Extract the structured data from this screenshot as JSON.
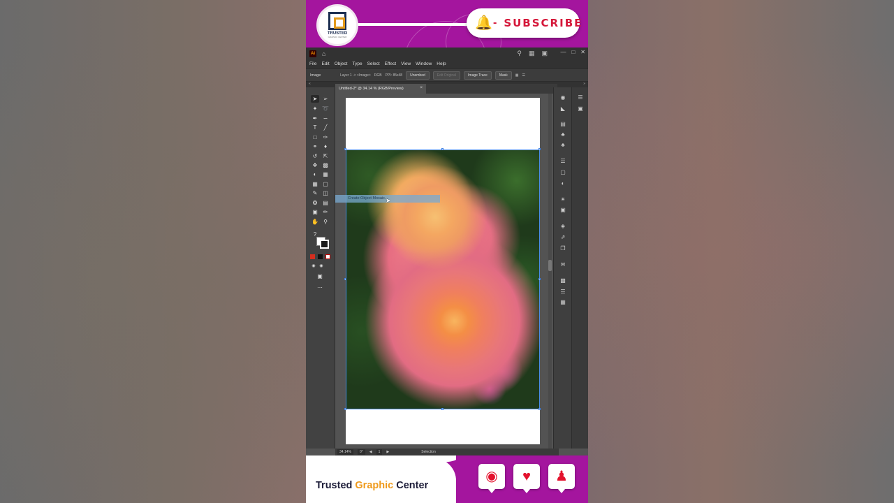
{
  "top_banner": {
    "logo_text": "TRUSTED",
    "logo_subtext": "GRAPHIC CENTER",
    "subscribe_label": "SUBSCRIBE",
    "subscribe_dash": "-"
  },
  "app": {
    "logo": "Ai",
    "menu": [
      "File",
      "Edit",
      "Object",
      "Type",
      "Select",
      "Effect",
      "View",
      "Window",
      "Help"
    ],
    "control_bar": {
      "object_type": "Image",
      "layer_info": "Layer 1 -> <Image>",
      "color_mode": "RGB",
      "ppi": "PPI: 85x48",
      "unembed_label": "Unembed",
      "edit_original_label": "Edit Original",
      "image_trace_label": "Image Trace",
      "mask_label": "Mask"
    },
    "document_tab": {
      "title": "Untitled-2* @ 34.14 % (RGB/Preview)",
      "close": "×"
    },
    "context_item": "Create Object Mosaic...",
    "status_bar": {
      "zoom": "34.14%",
      "rotation": "0°",
      "artboard": "1",
      "tool": "Selection"
    }
  },
  "bottom_banner": {
    "brand_part1": "Trusted ",
    "brand_accent": "Graphic",
    "brand_part2": " Center"
  },
  "colors": {
    "banner": "#a4159e",
    "accent": "#ef9a1c",
    "subscribe_red": "#d5183a",
    "icon_red": "#e3122d"
  },
  "icons": {
    "comment": "comment-icon",
    "like": "heart-icon",
    "profile": "user-icon",
    "bell": "bell-icon"
  }
}
